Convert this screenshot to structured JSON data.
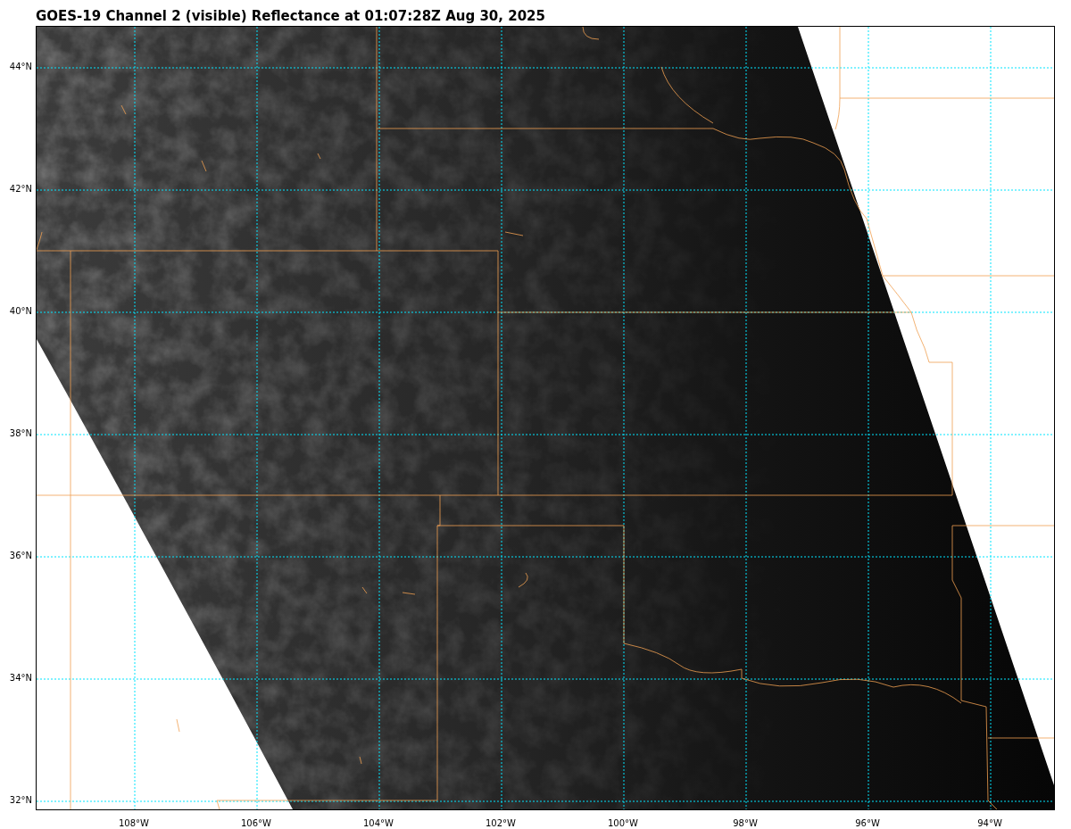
{
  "title": "GOES-19 Channel 2 (visible) Reflectance at 01:07:28Z Aug 30, 2025",
  "map": {
    "lat_labels": [
      "44°N",
      "42°N",
      "40°N",
      "38°N",
      "36°N",
      "34°N",
      "32°N"
    ],
    "lon_labels": [
      "108°W",
      "106°W",
      "104°W",
      "102°W",
      "100°W",
      "98°W",
      "96°W",
      "94°W"
    ]
  }
}
